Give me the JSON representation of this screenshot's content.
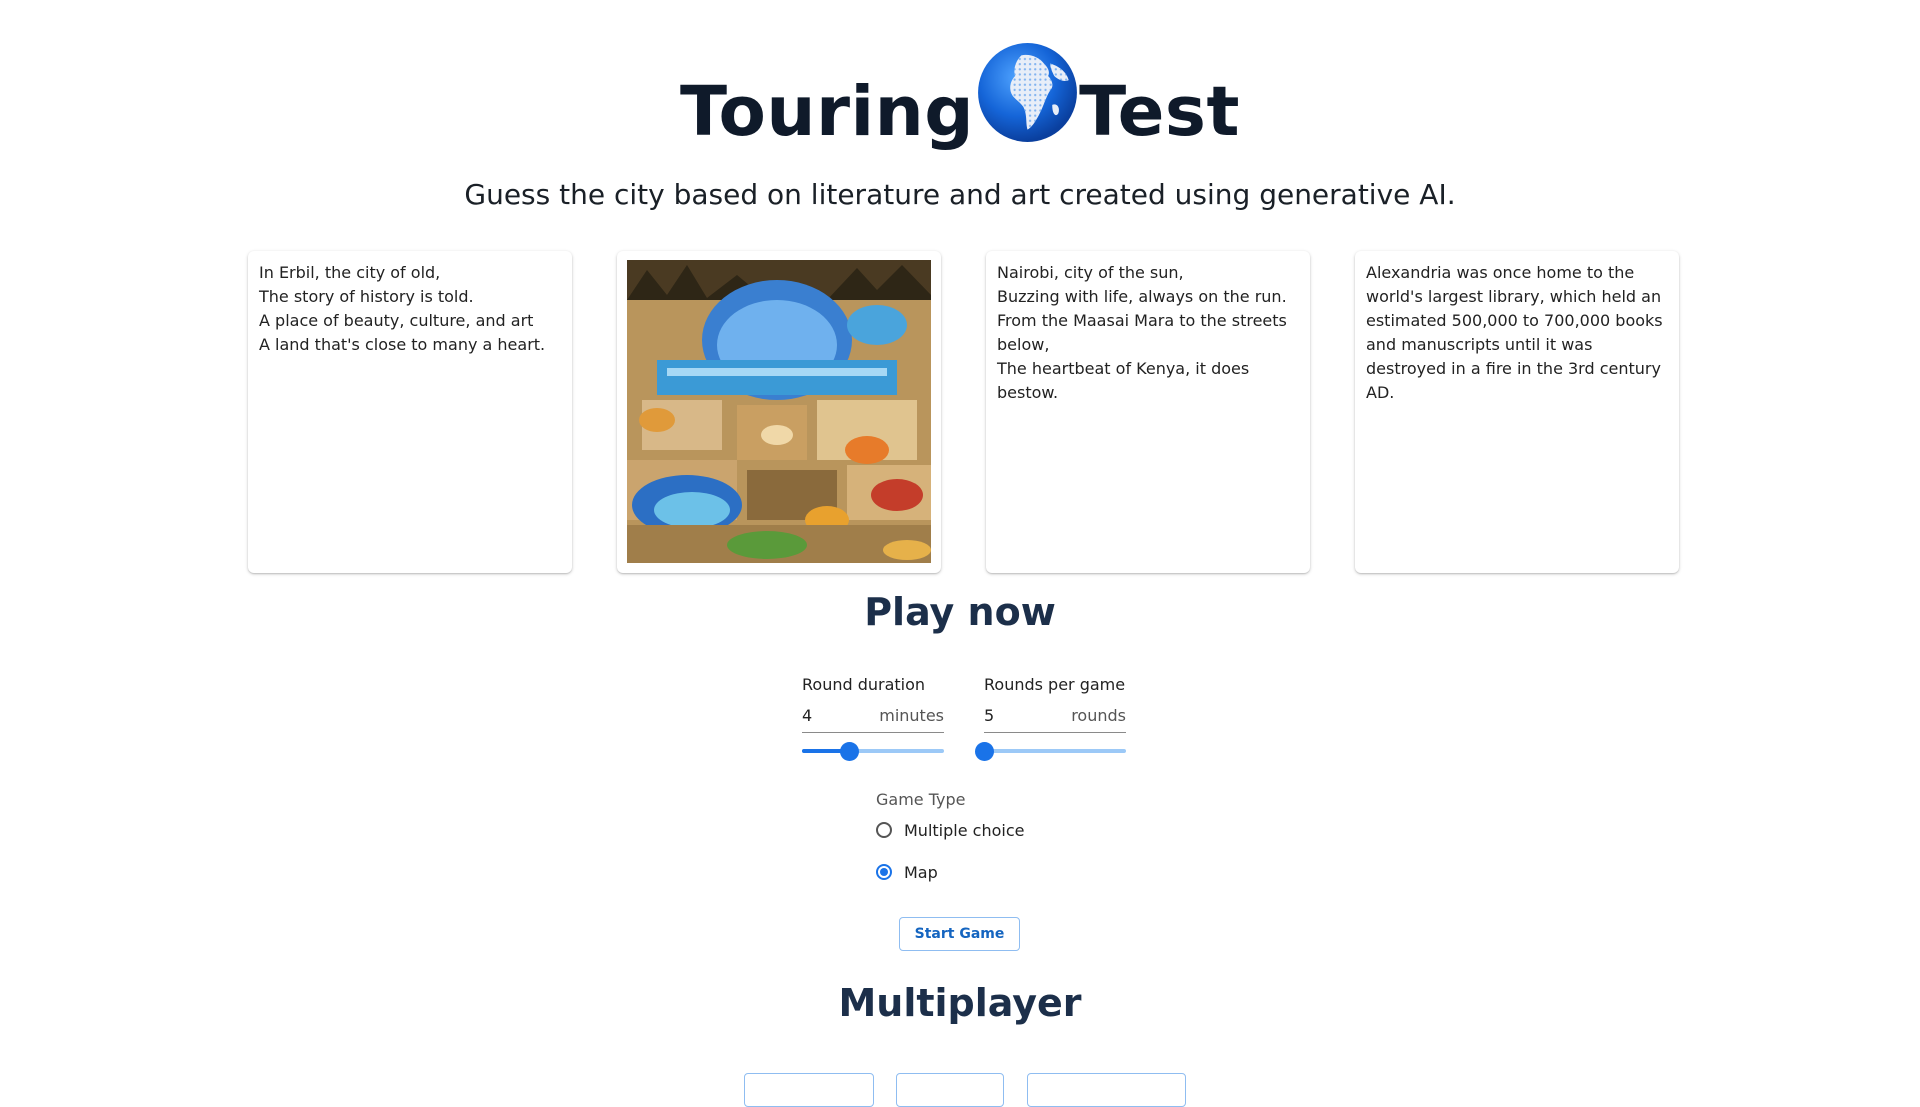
{
  "header": {
    "title_part1": "Touring",
    "title_part2": "Test",
    "subtitle": "Guess the city based on literature and art created using generative AI."
  },
  "cards": {
    "card1": {
      "lines": [
        "In Erbil, the city of old,",
        "The story of history is told.",
        "A place of beauty, culture, and art",
        "A land that's close to many a heart."
      ]
    },
    "card2": {
      "type": "image",
      "icon": "city-painting"
    },
    "card3": {
      "lines": [
        "Nairobi, city of the sun,",
        "Buzzing with life, always on the run.",
        "From the Maasai Mara to the streets below,",
        "The heartbeat of Kenya, it does bestow."
      ]
    },
    "card4": {
      "text": "Alexandria was once home to the world's largest library, which held an estimated 500,000 to 700,000 books and manuscripts until it was destroyed in a fire in the 3rd century AD."
    }
  },
  "play": {
    "title": "Play now",
    "round_duration": {
      "label": "Round duration",
      "value": "4",
      "unit": "minutes",
      "slider_fraction": 0.33
    },
    "rounds_per_game": {
      "label": "Rounds per game",
      "value": "5",
      "unit": "rounds",
      "slider_fraction": 0.0
    },
    "game_type": {
      "label": "Game Type",
      "options": [
        "Multiple choice",
        "Map"
      ],
      "selected": "Map"
    },
    "start_label": "Start Game"
  },
  "multiplayer": {
    "title": "Multiplayer"
  },
  "colors": {
    "accent": "#1a73e8",
    "title": "#0f1a2a",
    "heading": "#1c2f4a"
  }
}
